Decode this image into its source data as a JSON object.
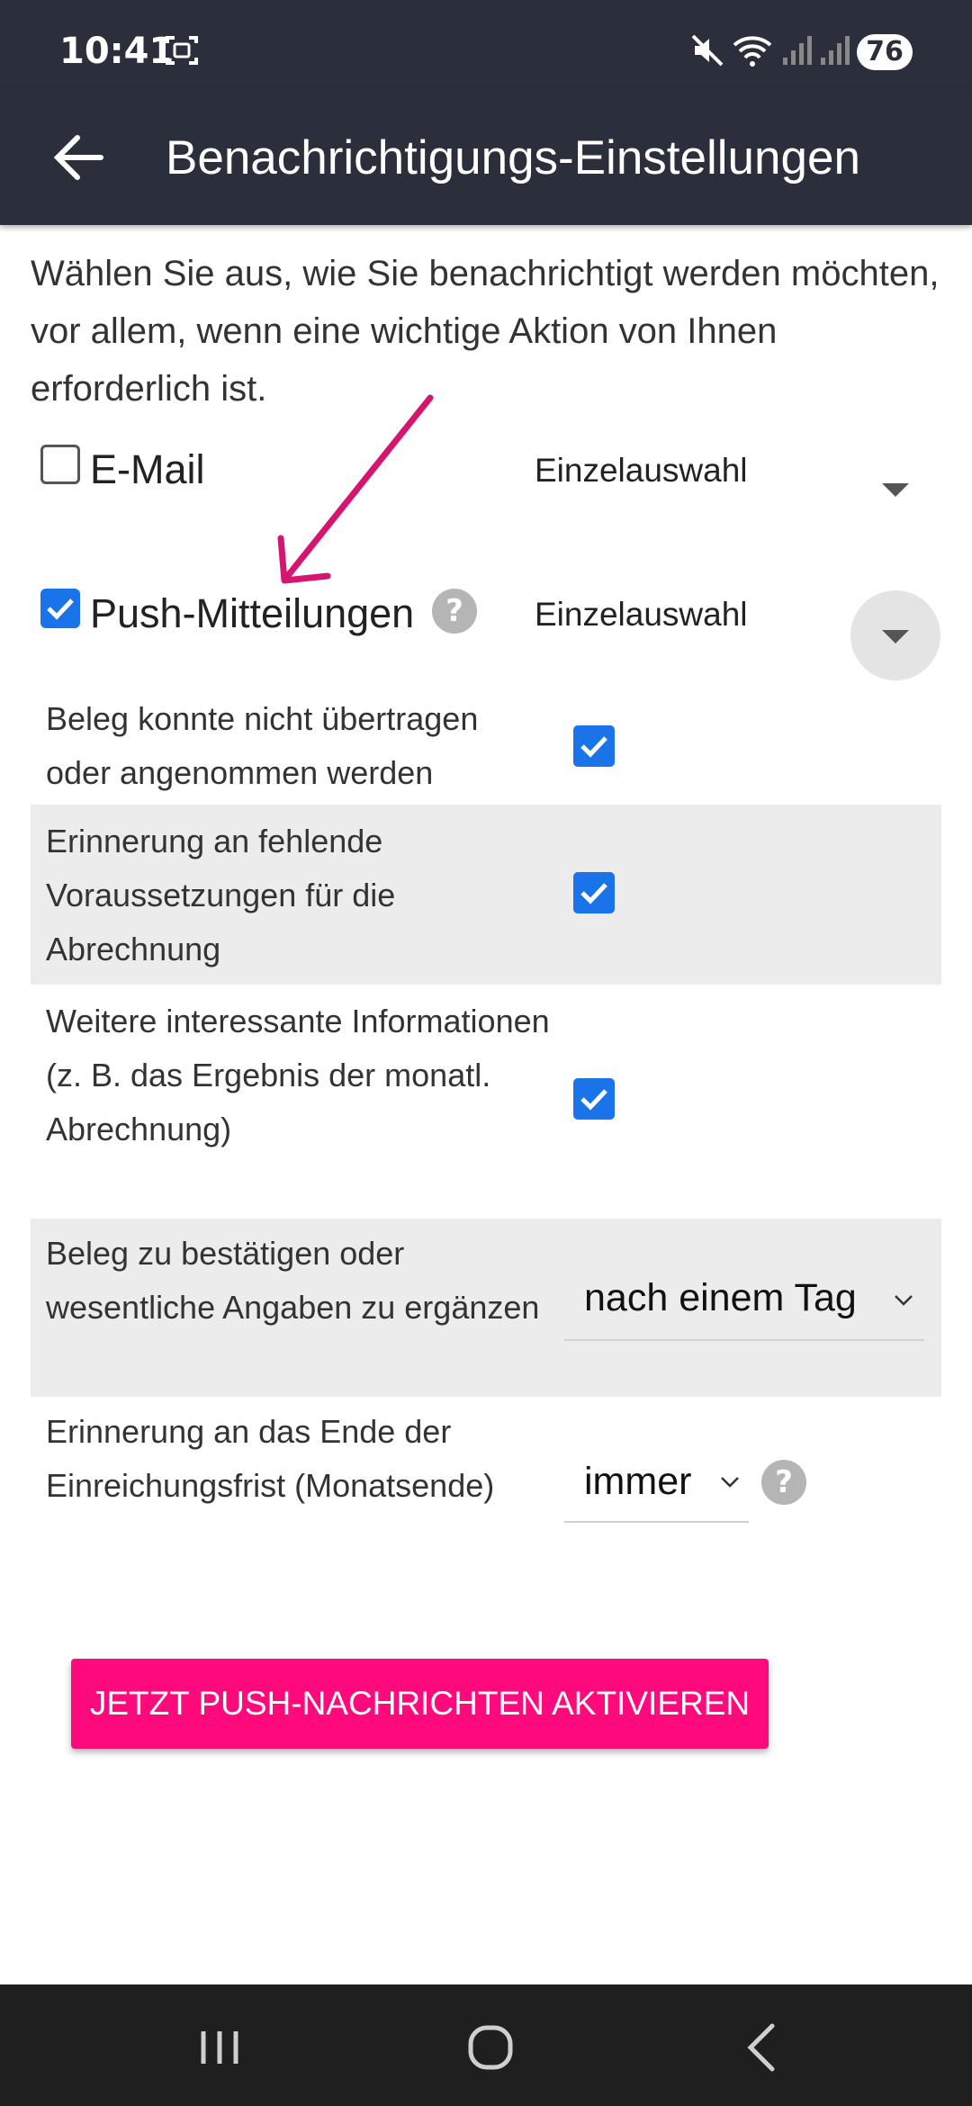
{
  "status_bar": {
    "time": "10:41",
    "battery": "76",
    "icons": [
      "screenshot-icon",
      "mute-icon",
      "wifi-icon",
      "signal-icon",
      "signal-icon"
    ]
  },
  "app_bar": {
    "title": "Benachrichtigungs-Einstellungen",
    "back_icon": "arrow-left-icon"
  },
  "intro": "Wählen Sie aus, wie Sie benachrichtigt werden möchten, vor allem, wenn eine wichtige Aktion von Ihnen erforderlich ist.",
  "channels": [
    {
      "label": "E-Mail",
      "checked": false,
      "mode": "Einzelauswahl"
    },
    {
      "label": "Push-Mitteilungen",
      "checked": true,
      "mode": "Einzelauswahl"
    }
  ],
  "settings": [
    {
      "label": "Beleg konnte nicht übertragen oder angenommen werden",
      "checked": true
    },
    {
      "label": "Erinnerung an fehlende Voraussetzungen für die Abrechnung",
      "checked": true
    },
    {
      "label": "Weitere interessante Informationen (z. B. das Ergebnis der monatl. Abrechnung)",
      "checked": true
    },
    {
      "label": "Beleg zu bestätigen oder wesentliche Angaben zu ergänzen",
      "value": "nach einem Tag"
    },
    {
      "label": "Erinnerung an das Ende der Einreichungsfrist (Monatsende)",
      "value": "immer"
    }
  ],
  "cta": {
    "label": "JETZT PUSH-NACHRICHTEN AKTIVIEREN"
  },
  "colors": {
    "appbar": "#2b2e3b",
    "accent": "#ff0a7d",
    "checkbox": "#1a73e8",
    "row_alt": "#ececec"
  },
  "nav_bar": {
    "icons": [
      "recent-apps-icon",
      "home-icon",
      "back-icon"
    ]
  }
}
